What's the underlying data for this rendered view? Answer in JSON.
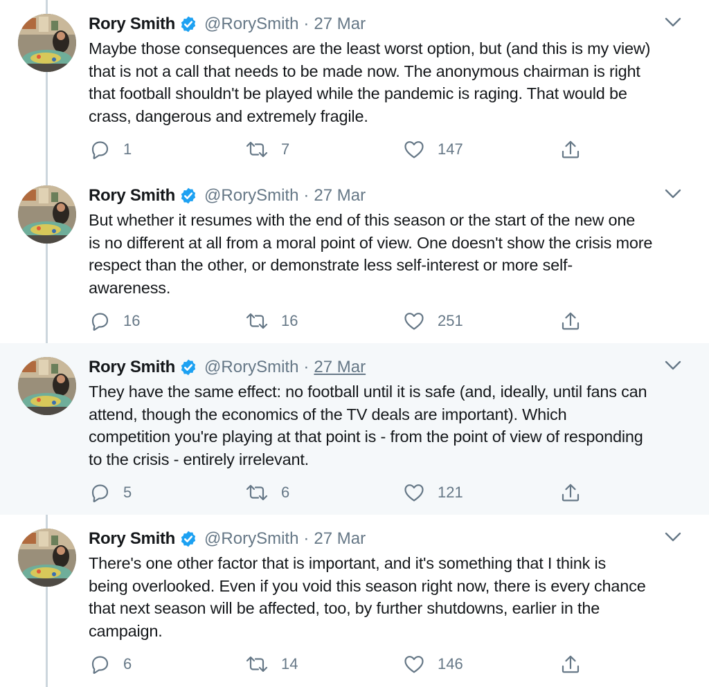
{
  "thread": {
    "tweets": [
      {
        "author_name": "Rory Smith",
        "handle": "@RorySmith",
        "separator": "·",
        "date": "27 Mar",
        "lines": [
          "Maybe those consequences are the least worst option, but (and this is my view)",
          "that is not a call that needs to  be made now. The anonymous chairman is right",
          "that football shouldn't be played while the pandemic is raging. That would be",
          "crass, dangerous and extremely fragile."
        ],
        "replies": "1",
        "retweets": "7",
        "likes": "147",
        "highlighted": false
      },
      {
        "author_name": "Rory Smith",
        "handle": "@RorySmith",
        "separator": "·",
        "date": "27 Mar",
        "lines": [
          "But whether it resumes with the end of this season or the start of the new one",
          "is no different at all from a moral point of view. One doesn't show the crisis more",
          "respect than the other, or demonstrate less self-interest or more self-",
          "awareness."
        ],
        "replies": "16",
        "retweets": "16",
        "likes": "251",
        "highlighted": false
      },
      {
        "author_name": "Rory Smith",
        "handle": "@RorySmith",
        "separator": "·",
        "date": "27 Mar",
        "lines": [
          "They have the same effect: no football until it is safe (and, ideally, until fans can",
          "attend, though the economics of the TV deals are important). Which",
          "competition you're playing at that point is - from the point of view of responding",
          "to the crisis - entirely irrelevant."
        ],
        "replies": "5",
        "retweets": "6",
        "likes": "121",
        "highlighted": true
      },
      {
        "author_name": "Rory Smith",
        "handle": "@RorySmith",
        "separator": "·",
        "date": "27 Mar",
        "lines": [
          "There's one other factor that is important, and it's something that I think is",
          "being overlooked. Even if you void this season right now, there is every chance",
          "that next season will be affected, too, by further shutdowns, earlier in the",
          "campaign."
        ],
        "replies": "6",
        "retweets": "14",
        "likes": "146",
        "highlighted": false
      }
    ]
  },
  "icons": {
    "verified": "verified-badge-icon",
    "more": "chevron-down-icon",
    "reply": "reply-icon",
    "retweet": "retweet-icon",
    "like": "heart-icon",
    "share": "share-icon"
  },
  "colors": {
    "verified": "#1da1f2",
    "secondary_text": "#657786",
    "icon": "#657786",
    "highlight_background": "#f5f8fa",
    "thread_line": "#ccd6dd"
  }
}
